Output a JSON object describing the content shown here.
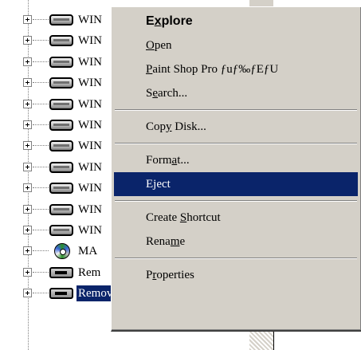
{
  "tree": {
    "items": [
      {
        "label": "WIN",
        "icon": "hard-drive-icon",
        "selected": false
      },
      {
        "label": "WIN",
        "icon": "hard-drive-icon",
        "selected": false
      },
      {
        "label": "WIN",
        "icon": "hard-drive-icon",
        "selected": false
      },
      {
        "label": "WIN",
        "icon": "hard-drive-icon",
        "selected": false
      },
      {
        "label": "WIN",
        "icon": "hard-drive-icon",
        "selected": false
      },
      {
        "label": "WIN",
        "icon": "hard-drive-icon",
        "selected": false
      },
      {
        "label": "WIN",
        "icon": "hard-drive-icon",
        "selected": false
      },
      {
        "label": "WIN",
        "icon": "hard-drive-icon",
        "selected": false
      },
      {
        "label": "WIN",
        "icon": "hard-drive-icon",
        "selected": false
      },
      {
        "label": "WIN",
        "icon": "hard-drive-icon",
        "selected": false
      },
      {
        "label": "WIN",
        "icon": "hard-drive-icon",
        "selected": false
      },
      {
        "label": "MA",
        "icon": "cd-drive-icon",
        "selected": false
      },
      {
        "label": "Rem",
        "icon": "removable-disk-icon",
        "selected": false
      },
      {
        "label": "Removable Disk (K:)",
        "icon": "removable-disk-icon",
        "selected": true
      }
    ]
  },
  "context_menu": {
    "items": [
      {
        "pre": "E",
        "acc": "x",
        "post": "plore",
        "name": "explore",
        "default": true
      },
      {
        "pre": "",
        "acc": "O",
        "post": "pen",
        "name": "open"
      },
      {
        "pre": "",
        "acc": "P",
        "post": "aint Shop Pro ƒuƒ‰ƒEƒU",
        "name": "paint-shop-pro"
      },
      {
        "pre": "S",
        "acc": "e",
        "post": "arch...",
        "name": "search"
      },
      {
        "separator": true
      },
      {
        "pre": "Cop",
        "acc": "y",
        "post": " Disk...",
        "name": "copy-disk"
      },
      {
        "separator": true
      },
      {
        "pre": "Form",
        "acc": "a",
        "post": "t...",
        "name": "format"
      },
      {
        "pre": "E",
        "acc": "j",
        "post": "ect",
        "name": "eject",
        "highlighted": true
      },
      {
        "separator": true
      },
      {
        "pre": "Create ",
        "acc": "S",
        "post": "hortcut",
        "name": "create-shortcut"
      },
      {
        "pre": "Rena",
        "acc": "m",
        "post": "e",
        "name": "rename"
      },
      {
        "separator": true
      },
      {
        "pre": "P",
        "acc": "r",
        "post": "operties",
        "name": "properties"
      }
    ]
  },
  "colors": {
    "menu_bg": "#d4d0c8",
    "highlight": "#0a246a",
    "highlight_text": "#ffffff"
  }
}
